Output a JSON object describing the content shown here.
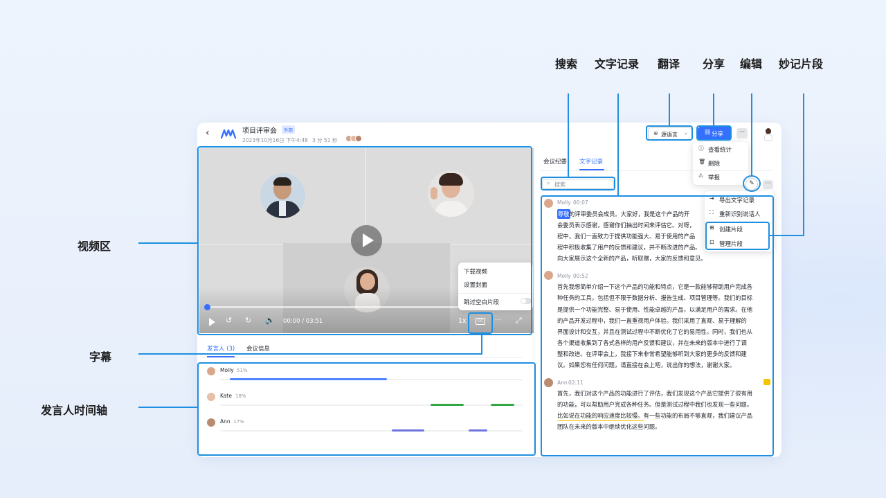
{
  "annotations": {
    "search": "搜索",
    "transcript": "文字记录",
    "translate": "翻译",
    "share": "分享",
    "edit": "编辑",
    "clips": "妙记片段",
    "video_area": "视频区",
    "subtitles": "字幕",
    "speaker_timeline": "发言人时间轴"
  },
  "header": {
    "title": "项目评审会",
    "external_badge": "外部",
    "date": "2023年10月16日 下午4:48",
    "duration": "3 分 51 秒",
    "language_button": "源语言",
    "share_button": "分享"
  },
  "share_menu": {
    "items": [
      "查看统计",
      "删除",
      "举报"
    ]
  },
  "player": {
    "time": "00:00 / 03:51",
    "speed": "1x",
    "more_menu": [
      "下载视频",
      "设置封面",
      "跳过空白片段"
    ],
    "progress": 0
  },
  "left_tabs": [
    "发言人 (3)",
    "会议信息"
  ],
  "speakers": [
    {
      "name": "Molly",
      "percent": "51%",
      "color": "#4e83fd"
    },
    {
      "name": "Kate",
      "percent": "18%",
      "color": "#32a645"
    },
    {
      "name": "Ann",
      "percent": "17%",
      "color": "#6f74dd"
    }
  ],
  "right_tabs": [
    "会议纪要",
    "文字记录"
  ],
  "search_placeholder": "搜索",
  "more_menu": [
    "导出文字记录",
    "重新识别说话人",
    "创建片段",
    "管理片段"
  ],
  "transcript": [
    {
      "speaker": "Molly",
      "time": "00:07",
      "highlight": "尊敬",
      "lines": [
        "的评审委员会成员。大家好，我是这个产品的开",
        "会委员表示感谢，感谢你们抽出时间来评估它。对呀，",
        "程中，我们一直致力于提供功能强大、易于使用的产品",
        "程中积极收集了用户的反馈和建议，并不断改进的产品。",
        "向大家展示这个全新的产品，听取赠，大家的反馈和意见。"
      ]
    },
    {
      "speaker": "Molly",
      "time": "00:52",
      "lines": [
        "首先我想简单介绍一下这个产品的功能和特点，它是一款能够帮助用户完成各",
        "种任务的工具，包括但不限于数据分析、报告生成、项目管理等。我们的目标",
        "是提供一个功能完整、易于使用、性能卓越的产品，以满足用户的需求。在他",
        "的产品开发过程中，我们一直重视用户体验。我们采用了直观、易于理解的",
        "界面设计和交互，并且在测试过程中不断优化了它的易用性。同时，我们也从",
        "各个渠道收集到了各式各样的用户反馈和建议，并在未来的版本中进行了调",
        "整和改进。在评审会上，我接下来非常希望能够听到大家的更多的反馈和建",
        "议。如果您有任何问题，请直接在会上吧，说出你的想法，谢谢大家。"
      ]
    },
    {
      "speaker": "Ann",
      "time": "02:11",
      "lines": [
        "首先，我们对这个产品的功能进行了评估，我们发现这个产品它提供了很有用",
        "的功能，可以帮助用户完成各种任务。但是测试过程中我们也发现一些问题，",
        "比如说在功能的响应速度比较慢。有一些功能的布局不够直观，我们建议产品",
        "团队在未来的版本中继续优化这些问题。"
      ]
    }
  ]
}
